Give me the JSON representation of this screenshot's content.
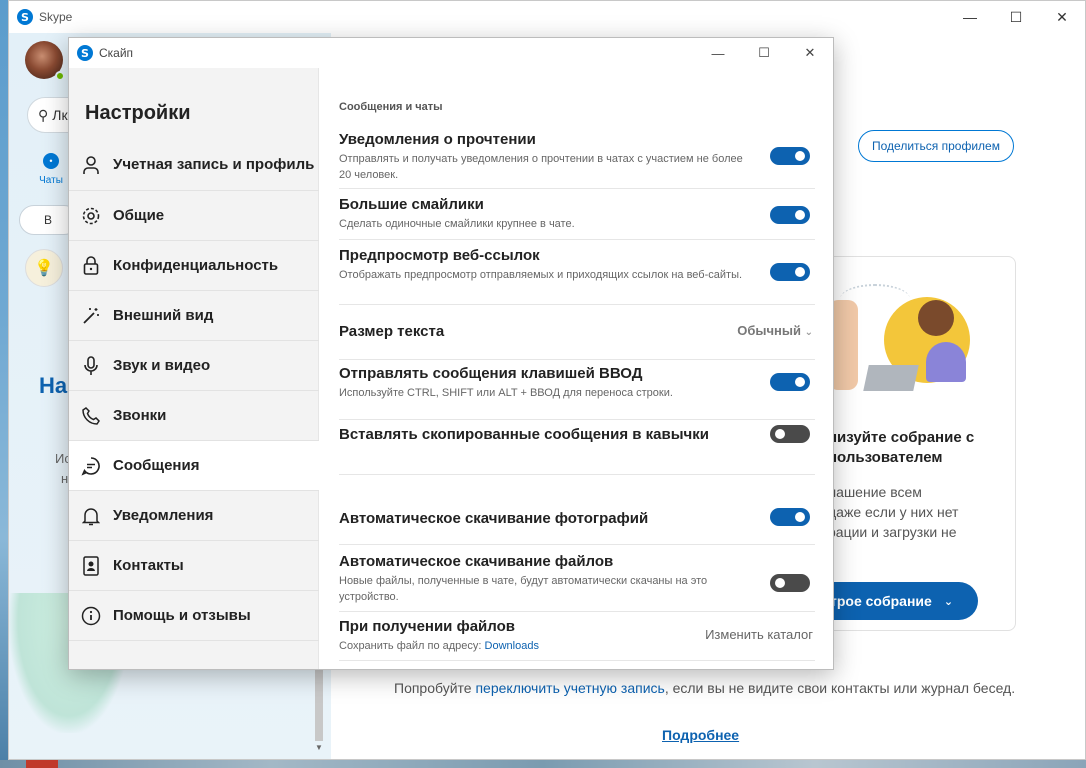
{
  "main_window": {
    "title": "Skype",
    "search_placeholder": "Лк",
    "nav_chats_label": "Чаты",
    "meet_partial": "В",
    "side_heading_partial": "На",
    "side_text_1": "Ис",
    "side_text_2": "н",
    "share_profile_button": "Поделиться профилем",
    "card": {
      "title_line1": "низуйте собрание с",
      "title_line2": "пользователем",
      "text_line1": "лашение всем",
      "text_line2": "даже если у них нет",
      "text_line3": "рации и загрузки не",
      "button_label": "трое собрание"
    },
    "signed_in_partial": "",
    "try_prefix": "Попробуйте ",
    "try_link": "переключить учетную запись",
    "try_suffix": ", если вы не видите свои контакты или журнал бесед.",
    "more_link": "Подробнее"
  },
  "dialog": {
    "title": "Скайп",
    "heading": "Настройки",
    "nav": [
      {
        "label": "Учетная запись и профиль",
        "icon": "person-icon"
      },
      {
        "label": "Общие",
        "icon": "gear-icon"
      },
      {
        "label": "Конфиденциальность",
        "icon": "lock-icon"
      },
      {
        "label": "Внешний вид",
        "icon": "magic-wand-icon"
      },
      {
        "label": "Звук и видео",
        "icon": "microphone-icon"
      },
      {
        "label": "Звонки",
        "icon": "phone-icon"
      },
      {
        "label": "Сообщения",
        "icon": "message-icon"
      },
      {
        "label": "Уведомления",
        "icon": "bell-icon"
      },
      {
        "label": "Контакты",
        "icon": "contacts-icon"
      },
      {
        "label": "Помощь и отзывы",
        "icon": "info-icon"
      }
    ],
    "section_title": "Сообщения и чаты",
    "settings": [
      {
        "title": "Уведомления о прочтении",
        "desc": "Отправлять и получать уведомления о прочтении в чатах с участием не более 20 человек.",
        "toggle": true
      },
      {
        "title": "Большие смайлики",
        "desc": "Сделать одиночные смайлики крупнее в чате.",
        "toggle": true
      },
      {
        "title": "Предпросмотр веб-ссылок",
        "desc": "Отображать предпросмотр отправляемых и приходящих ссылок на веб-сайты.",
        "toggle": true
      },
      {
        "title": "Размер текста",
        "value": "Обычный"
      },
      {
        "title": "Отправлять сообщения клавишей ВВОД",
        "desc": "Используйте CTRL, SHIFT или ALT + ВВОД для переноса строки.",
        "toggle": true
      },
      {
        "title": "Вставлять скопированные сообщения в кавычки",
        "toggle": false
      },
      {
        "title": "Автоматическое скачивание фотографий",
        "toggle": true
      },
      {
        "title": "Автоматическое скачивание файлов",
        "desc": "Новые файлы, полученные в чате, будут автоматически скачаны на это устройство.",
        "toggle": false
      },
      {
        "title": "При получении файлов",
        "desc_prefix": "Сохранить файл по адресу: ",
        "desc_link": "Downloads",
        "value": "Изменить каталог"
      }
    ]
  },
  "colors": {
    "accent": "#0d62b0",
    "toggle_off": "#4a4a4a",
    "online": "#6bb700"
  }
}
